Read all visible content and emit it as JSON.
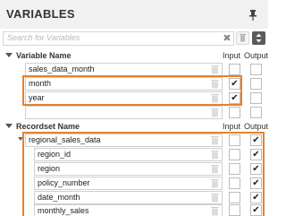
{
  "panel": {
    "title": "VARIABLES",
    "pin_icon": "pin-icon"
  },
  "search": {
    "placeholder": "Search for Variables",
    "clear_icon": "close-icon",
    "delete_icon": "trash-icon",
    "sort_icon": "sort-icon"
  },
  "variables_section": {
    "header": "Variable  Name",
    "col_input": "Input",
    "col_output": "Output",
    "rows": [
      {
        "name": "sales_data_month",
        "input": false,
        "output": false
      },
      {
        "name": "month",
        "input": true,
        "output": false
      },
      {
        "name": "year",
        "input": true,
        "output": false
      },
      {
        "name": "",
        "input": false,
        "output": false
      }
    ]
  },
  "recordset_section": {
    "header": "Recordset  Name",
    "col_input": "Input",
    "col_output": "Output",
    "recordset": {
      "name": "regional_sales_data",
      "input": false,
      "output": true
    },
    "fields": [
      {
        "name": "region_id",
        "input": false,
        "output": true
      },
      {
        "name": "region",
        "input": false,
        "output": true
      },
      {
        "name": "policy_number",
        "input": false,
        "output": true
      },
      {
        "name": "date_month",
        "input": false,
        "output": true
      },
      {
        "name": "monthly_sales",
        "input": false,
        "output": true
      }
    ]
  },
  "colors": {
    "highlight": "#e8822a",
    "header_bg": "#f1f1f1"
  }
}
